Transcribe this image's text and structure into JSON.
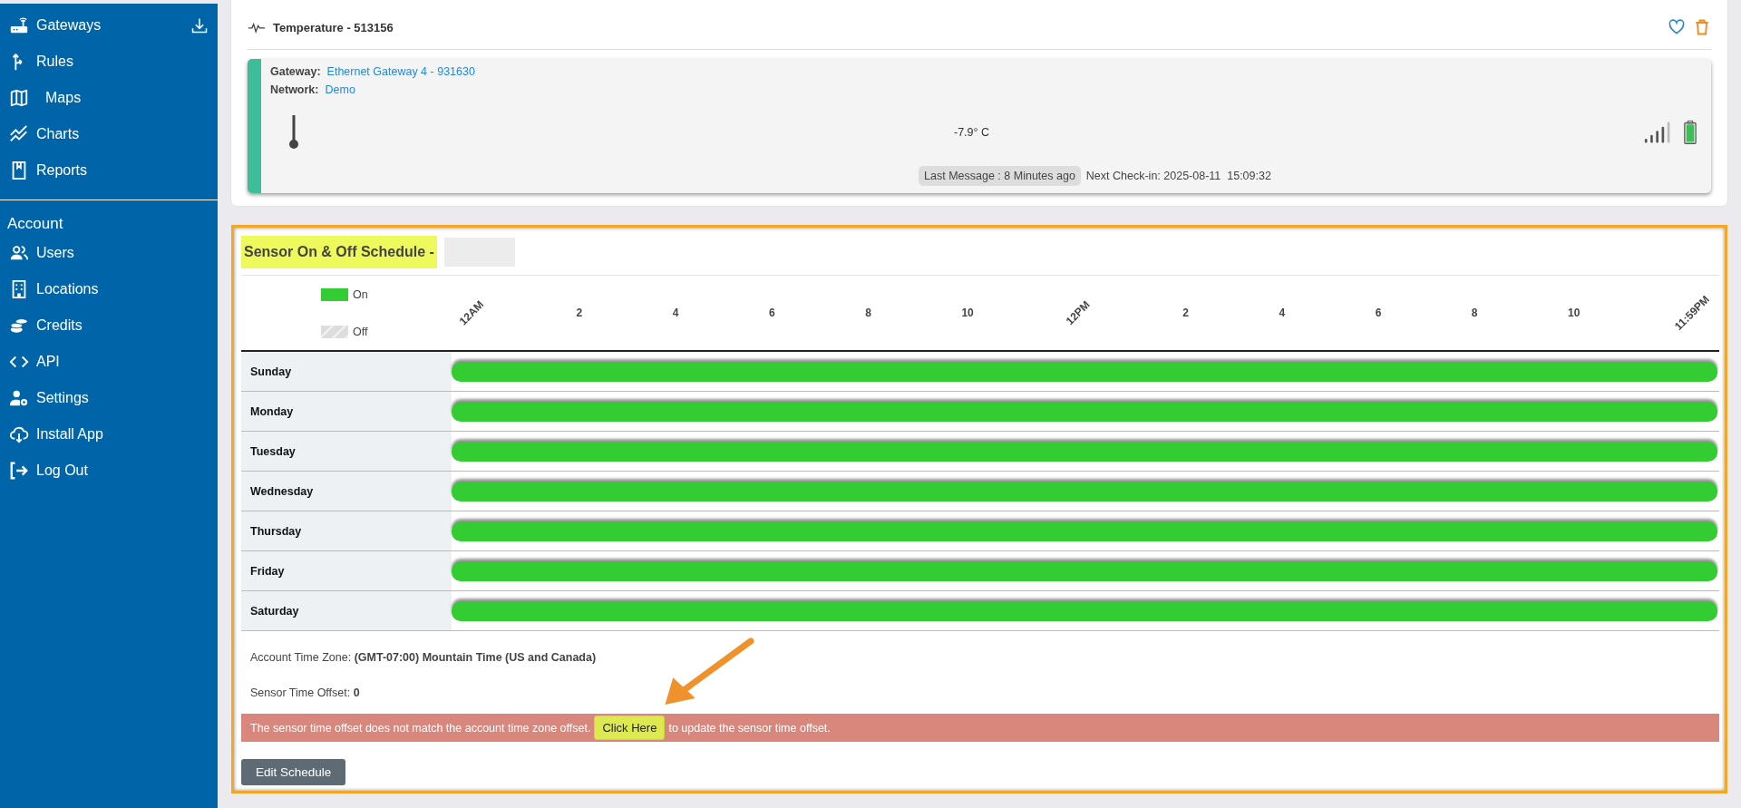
{
  "sidebar": {
    "items": [
      {
        "label": "Gateways"
      },
      {
        "label": "Rules"
      },
      {
        "label": "Maps"
      },
      {
        "label": "Charts"
      },
      {
        "label": "Reports"
      }
    ],
    "account": {
      "title": "Account",
      "items": [
        {
          "label": "Users"
        },
        {
          "label": "Locations"
        },
        {
          "label": "Credits"
        },
        {
          "label": "API"
        },
        {
          "label": "Settings"
        },
        {
          "label": "Install App"
        },
        {
          "label": "Log Out"
        }
      ]
    }
  },
  "sensor_card": {
    "title": "Temperature - 513156",
    "gateway_label": "Gateway:",
    "gateway": "Ethernet Gateway 4 - 931630",
    "network_label": "Network:",
    "network": "Demo",
    "reading": "-7.9° C",
    "last_message": "Last Message : 8 Minutes ago",
    "next_checkin": "Next Check-in: 2025-08-11  15:09:32"
  },
  "schedule": {
    "title": "Sensor On & Off Schedule -",
    "legend": [
      {
        "kind": "on",
        "label": "On"
      },
      {
        "kind": "off",
        "label": "Off"
      }
    ],
    "hours": [
      {
        "label": "12AM",
        "rotated": true
      },
      {
        "label": "2",
        "rotated": false
      },
      {
        "label": "4",
        "rotated": false
      },
      {
        "label": "6",
        "rotated": false
      },
      {
        "label": "8",
        "rotated": false
      },
      {
        "label": "10",
        "rotated": false
      },
      {
        "label": "12PM",
        "rotated": true
      },
      {
        "label": "2",
        "rotated": false
      },
      {
        "label": "4",
        "rotated": false
      },
      {
        "label": "6",
        "rotated": false
      },
      {
        "label": "8",
        "rotated": false
      },
      {
        "label": "10",
        "rotated": false
      },
      {
        "label": "11:59PM",
        "rotated": true
      }
    ],
    "days": [
      {
        "name": "Sunday",
        "on": true
      },
      {
        "name": "Monday",
        "on": true
      },
      {
        "name": "Tuesday",
        "on": true
      },
      {
        "name": "Wednesday",
        "on": true
      },
      {
        "name": "Thursday",
        "on": true
      },
      {
        "name": "Friday",
        "on": true
      },
      {
        "name": "Saturday",
        "on": true
      }
    ],
    "time_zone": "Account Time Zone: **(GMT-07:00) Mountain Time (US and Canada)**",
    "time_offset": "Sensor Time Offset: **0**",
    "alert": {
      "before": "The sensor time offset does not match the account time zone offset.",
      "button": "Click Here",
      "after": "to update the sensor time offset."
    },
    "edit_button": "Edit Schedule"
  }
}
